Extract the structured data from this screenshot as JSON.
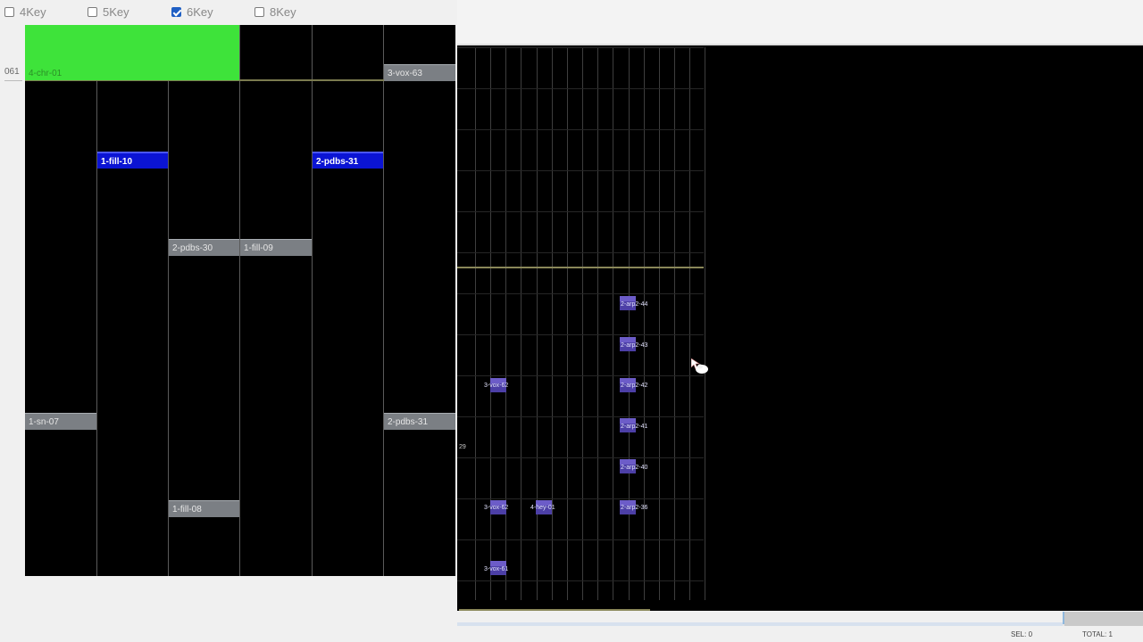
{
  "key_options": [
    {
      "label": "4Key",
      "checked": false
    },
    {
      "label": "5Key",
      "checked": false
    },
    {
      "label": "6Key",
      "checked": true
    },
    {
      "label": "8Key",
      "checked": false
    }
  ],
  "measure_label": "061",
  "lane_notes": {
    "chr": "4-chr-01",
    "vox63": "3-vox-63",
    "fill10": "1-fill-10",
    "pdbs31a": "2-pdbs-31",
    "pdbs30": "2-pdbs-30",
    "fill09": "1-fill-09",
    "sn07": "1-sn-07",
    "pdbs31b": "2-pdbs-31",
    "fill08": "1-fill-08"
  },
  "samples": {
    "arp44": "2-arp2-44",
    "arp43": "2-arp2-43",
    "arp42": "2-arp2-42",
    "arp41": "2-arp2-41",
    "arp40": "2-arp2-40",
    "arp36": "2-arp2-36",
    "vox62a": "3-vox-62",
    "vox62b": "3-vox-62",
    "hey01": "4-hey-01",
    "vox61": "3-vox-61"
  },
  "edge_label": "29",
  "status": {
    "sel": "SEL: 0",
    "total": "TOTAL: 1"
  },
  "colors": {
    "lane_background": "#000000",
    "note_gray": "#7b7f84",
    "note_blue": "#0b14d4",
    "note_green": "#3ee33a",
    "sample_purple": "#5a4bb8"
  }
}
